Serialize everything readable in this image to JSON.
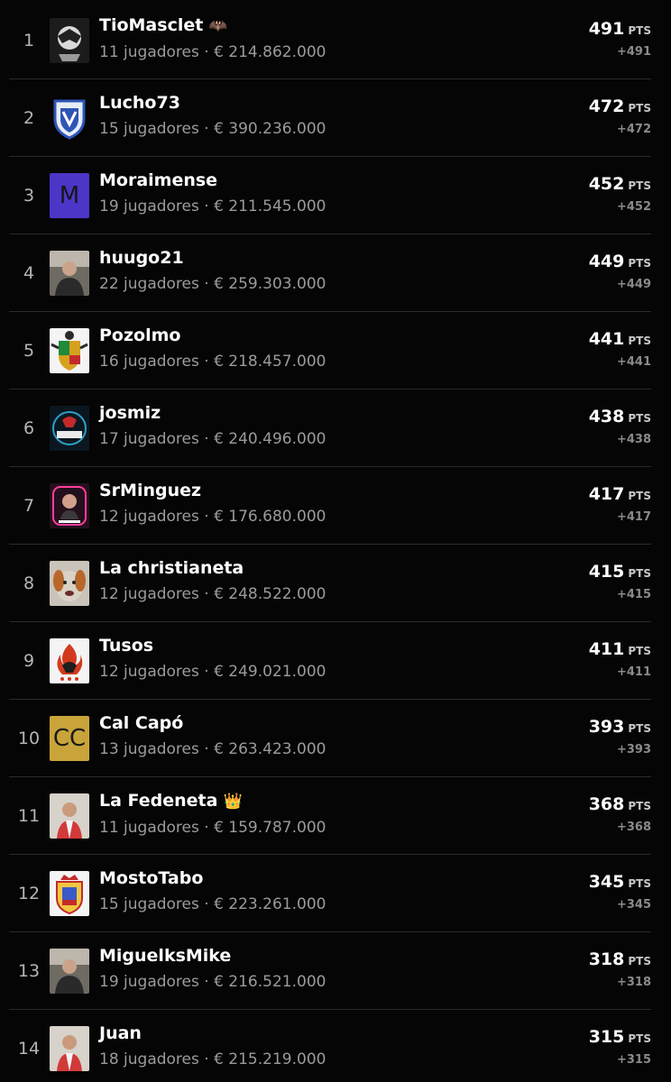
{
  "colors": {
    "background": "#050505",
    "divider": "#2a2a2a",
    "name_text": "#ffffff",
    "meta_text": "#9b9b9b",
    "delta_text": "#8a8a8a"
  },
  "points_unit": "PTS",
  "rows": [
    {
      "rank": "1",
      "name": "TioMasclet",
      "badge": "🦇",
      "meta": "11 jugadores · € 214.862.000",
      "points": "491",
      "delta": "+491",
      "avatar": "masked-hero-icon"
    },
    {
      "rank": "2",
      "name": "Lucho73",
      "badge": "",
      "meta": "15 jugadores · € 390.236.000",
      "points": "472",
      "delta": "+472",
      "avatar": "club-shield-icon"
    },
    {
      "rank": "3",
      "name": "Moraimense",
      "badge": "",
      "meta": "19 jugadores · € 211.545.000",
      "points": "452",
      "delta": "+452",
      "avatar": "letter-avatar",
      "avatar_letter": "M",
      "avatar_color": "#4b36c8"
    },
    {
      "rank": "4",
      "name": "huugo21",
      "badge": "",
      "meta": "22 jugadores · € 259.303.000",
      "points": "449",
      "delta": "+449",
      "avatar": "person-photo-icon"
    },
    {
      "rank": "5",
      "name": "Pozolmo",
      "badge": "",
      "meta": "16 jugadores · € 218.457.000",
      "points": "441",
      "delta": "+441",
      "avatar": "coat-of-arms-icon"
    },
    {
      "rank": "6",
      "name": "josmiz",
      "badge": "",
      "meta": "17 jugadores · € 240.496.000",
      "points": "438",
      "delta": "+438",
      "avatar": "logo-badge-icon"
    },
    {
      "rank": "7",
      "name": "SrMinguez",
      "badge": "",
      "meta": "12 jugadores · € 176.680.000",
      "points": "417",
      "delta": "+417",
      "avatar": "neon-portrait-icon"
    },
    {
      "rank": "8",
      "name": "La christianeta",
      "badge": "",
      "meta": "12 jugadores · € 248.522.000",
      "points": "415",
      "delta": "+415",
      "avatar": "dog-photo-icon"
    },
    {
      "rank": "9",
      "name": "Tusos",
      "badge": "",
      "meta": "12 jugadores · € 249.021.000",
      "points": "411",
      "delta": "+411",
      "avatar": "flame-crest-icon"
    },
    {
      "rank": "10",
      "name": "Cal Capó",
      "badge": "",
      "meta": "13 jugadores · € 263.423.000",
      "points": "393",
      "delta": "+393",
      "avatar": "letter-avatar",
      "avatar_letter": "CC",
      "avatar_color": "#c9a43a"
    },
    {
      "rank": "11",
      "name": "La Fedeneta",
      "badge": "👑",
      "meta": "11 jugadores · € 159.787.000",
      "points": "368",
      "delta": "+368",
      "avatar": "player-photo-icon"
    },
    {
      "rank": "12",
      "name": "MostoTabo",
      "badge": "",
      "meta": "15 jugadores · € 223.261.000",
      "points": "345",
      "delta": "+345",
      "avatar": "royal-crest-icon"
    },
    {
      "rank": "13",
      "name": "MiguelksMike",
      "badge": "",
      "meta": "19 jugadores · € 216.521.000",
      "points": "318",
      "delta": "+318",
      "avatar": "person-photo-icon"
    },
    {
      "rank": "14",
      "name": "Juan",
      "badge": "",
      "meta": "18 jugadores · € 215.219.000",
      "points": "315",
      "delta": "+315",
      "avatar": "player-photo-icon"
    }
  ]
}
